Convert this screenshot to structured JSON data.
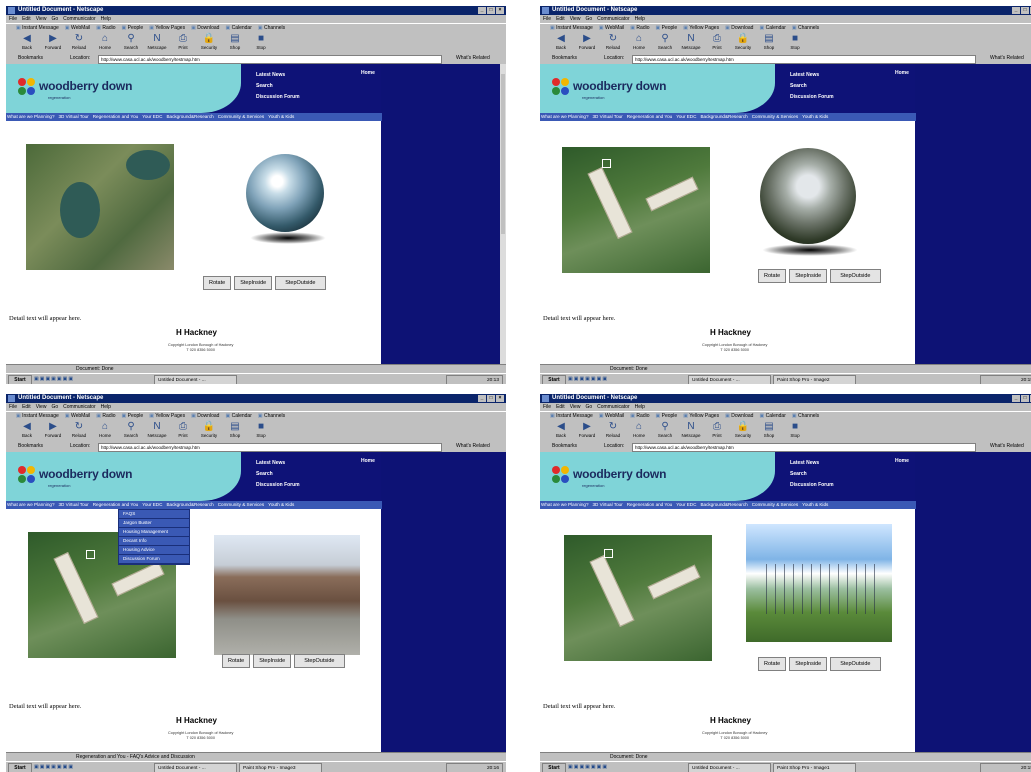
{
  "browser": {
    "title": "Untitled Document - Netscape",
    "menu": [
      "File",
      "Edit",
      "View",
      "Go",
      "Communicator",
      "Help"
    ],
    "personal_toolbar": [
      "Instant Message",
      "WebMail",
      "Radio",
      "People",
      "Yellow Pages",
      "Download",
      "Calendar",
      "Channels"
    ],
    "nav_buttons": [
      "Back",
      "Forward",
      "Reload",
      "Home",
      "Search",
      "Netscape",
      "Print",
      "Security",
      "Shop",
      "Stop"
    ],
    "bookmarks_label": "Bookmarks",
    "location_label": "Location:",
    "url": "http://www.casa.ucl.ac.uk/woodberry/testmap.htm",
    "whats_related": "What's Related"
  },
  "site": {
    "logo_text": "woodberry down",
    "logo_sub": "regeneration",
    "header_links": [
      "Latest News",
      "Search",
      "Discussion Forum"
    ],
    "home_label": "Home",
    "nav": [
      "What are we Planning?",
      "3D Virtual Tour",
      "Regeneration and You",
      "Your EDC",
      "Background&Research",
      "Community & Services",
      "Youth & Kids"
    ],
    "buttons": [
      "Rotate",
      "StepInside",
      "StepOutside"
    ],
    "detail_text": "Detail text will appear here.",
    "footer_brand": "H Hackney",
    "footer_copyright": "Copyright London Borough of Hackney",
    "footer_phone": "T 020 8356 5000"
  },
  "dropdown_items": [
    "FAQS",
    "Jargon Buster",
    "Housing Management",
    "Decant Info",
    "Housing Advice",
    "Discussion Forum"
  ],
  "status": {
    "done": "Document: Done",
    "menu_hover": "Regeneration and You - FAQ's Advice and Discussion"
  },
  "taskbar": {
    "start": "Start",
    "doc_task": "Untitled Document - ...",
    "psp_tasks": [
      "Paint Shop Pro - Image2",
      "Paint Shop Pro - Image3",
      "Paint Shop Pro - Image1"
    ],
    "clocks": [
      "20:13",
      "20:15",
      "20:16",
      "20:15"
    ]
  },
  "colors": {
    "site_navy": "#0e1277",
    "nav_blue": "#3a59b5",
    "logo_teal": "#7fd4d8",
    "titlebar": "#0a246a"
  },
  "icons": [
    "flower-logo-icon",
    "browser-window-icon",
    "back-icon",
    "reload-icon",
    "home-icon",
    "search-icon",
    "print-icon",
    "security-icon",
    "shop-icon",
    "stop-icon"
  ]
}
